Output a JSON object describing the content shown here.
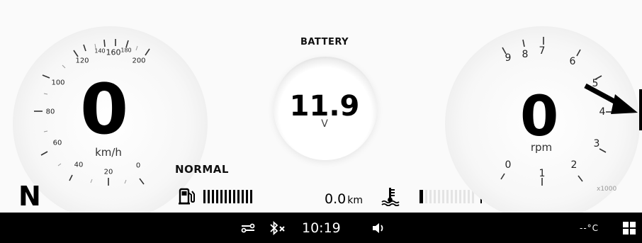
{
  "speedometer": {
    "value": "0",
    "unit": "km/h",
    "ticks": [
      "0",
      "20",
      "40",
      "60",
      "80",
      "100",
      "120",
      "140",
      "160",
      "180",
      "200"
    ]
  },
  "gear": "N",
  "battery": {
    "title": "BATTERY",
    "value": "11.9",
    "unit": "V"
  },
  "ride_mode": "NORMAL",
  "fuel": {
    "icon": "fuel-pump-icon",
    "level_fraction": 1.0
  },
  "trip": {
    "value": "0.0",
    "unit": "km"
  },
  "coolant": {
    "icon": "coolant-temperature-icon",
    "level_fraction": 0.1
  },
  "tachometer": {
    "value": "0",
    "unit": "rpm",
    "scale_label": "x1000",
    "ticks": [
      "0",
      "1",
      "2",
      "3",
      "4",
      "5",
      "6",
      "7",
      "8",
      "9"
    ]
  },
  "status_bar": {
    "time": "10:19",
    "outside_temp": "--°C",
    "icons": [
      "connection-icon",
      "bluetooth-disconnected-icon",
      "volume-icon",
      "menu-grid-icon"
    ]
  },
  "colors": {
    "background": "#fafafa",
    "text": "#000000",
    "status_bar": "#000000"
  }
}
